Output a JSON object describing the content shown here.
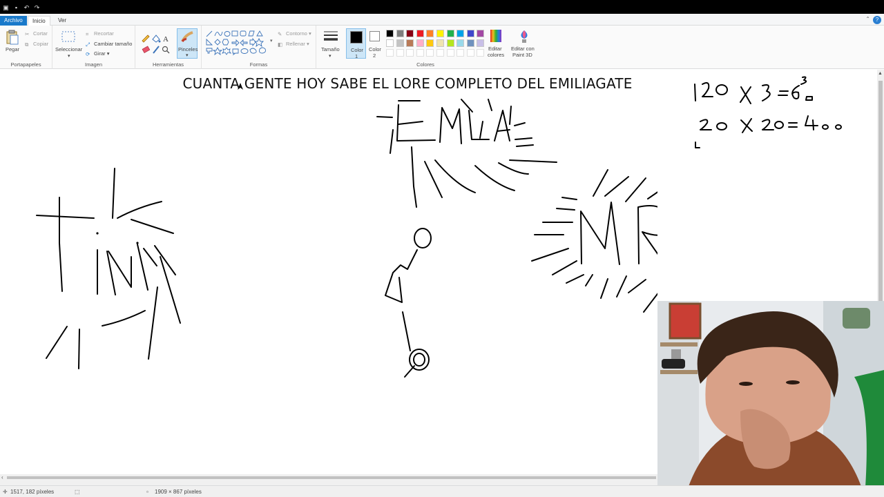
{
  "quick_access": [
    "paint-app-icon",
    "save-icon",
    "undo-icon",
    "redo-icon"
  ],
  "tabs": {
    "file": "Archivo",
    "home": "Inicio",
    "view": "Ver"
  },
  "ribbon": {
    "clipboard": {
      "paste": "Pegar",
      "cut": "Cortar",
      "copy": "Copiar",
      "label": "Portapapeles"
    },
    "image": {
      "select": "Seleccionar",
      "crop": "Recortar",
      "resize": "Cambiar tamaño",
      "rotate": "Girar",
      "label": "Imagen"
    },
    "tools": {
      "label": "Herramientas",
      "brushes": "Pinceles"
    },
    "shapes": {
      "outline": "Contorno",
      "fill": "Rellenar",
      "label": "Formas"
    },
    "size": "Tamaño",
    "color1": "Color",
    "color1_num": "1",
    "color2": "Color",
    "color2_num": "2",
    "colors": {
      "label": "Colores",
      "edit": "Editar",
      "edit2": "colores",
      "palette_row1": [
        "#000000",
        "#7f7f7f",
        "#880015",
        "#ed1c24",
        "#ff7f27",
        "#fff200",
        "#22b14c",
        "#00a2e8",
        "#3f48cc",
        "#a349a4"
      ],
      "palette_row2": [
        "#ffffff",
        "#c3c3c3",
        "#b97a57",
        "#ffaec9",
        "#ffc90e",
        "#efe4b0",
        "#b5e61d",
        "#99d9ea",
        "#7092be",
        "#c8bfe7"
      ]
    },
    "paint3d": "Editar con",
    "paint3d2": "Paint 3D"
  },
  "canvas": {
    "headline": "CUANTA GENTE HOY SABE EL LORE COMPLETO DEL EMILIAGATE"
  },
  "status": {
    "cursor_pos": "1517, 182 píxeles",
    "image_size": "1909 × 867 píxeles"
  }
}
